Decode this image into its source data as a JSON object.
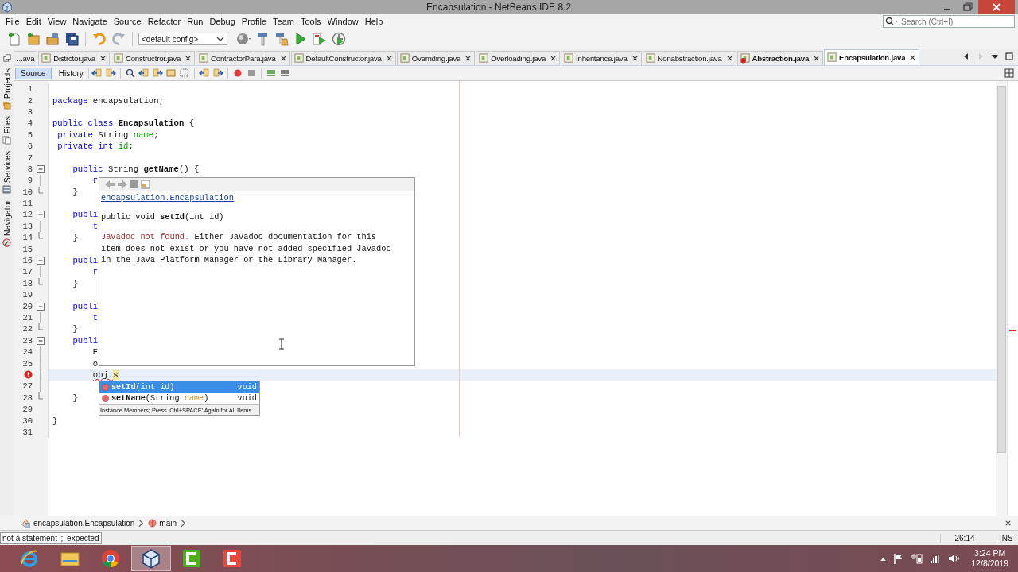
{
  "window": {
    "title": "Encapsulation - NetBeans IDE 8.2"
  },
  "menu": [
    "File",
    "Edit",
    "View",
    "Navigate",
    "Source",
    "Refactor",
    "Run",
    "Debug",
    "Profile",
    "Team",
    "Tools",
    "Window",
    "Help"
  ],
  "toolbar": {
    "config": "<default config>",
    "search": {
      "placeholder": "Search (Ctrl+I)"
    }
  },
  "side_tabs": [
    {
      "label": "Projects",
      "kind": "projects"
    },
    {
      "label": "Files",
      "kind": "files"
    },
    {
      "label": "Services",
      "kind": "services"
    },
    {
      "label": "Navigator",
      "kind": "navigator"
    }
  ],
  "tabs": [
    {
      "label": "...ava",
      "selected": false,
      "modified": false,
      "error": false,
      "closable": false
    },
    {
      "label": "Distrctor.java",
      "selected": false,
      "modified": false,
      "error": false,
      "closable": true
    },
    {
      "label": "Constructror.java",
      "selected": false,
      "modified": false,
      "error": false,
      "closable": true
    },
    {
      "label": "ContractorPara.java",
      "selected": false,
      "modified": false,
      "error": false,
      "closable": true
    },
    {
      "label": "DefaultConstructor.java",
      "selected": false,
      "modified": false,
      "error": false,
      "closable": true
    },
    {
      "label": "Overriding.java",
      "selected": false,
      "modified": false,
      "error": false,
      "closable": true
    },
    {
      "label": "Overloading.java",
      "selected": false,
      "modified": false,
      "error": false,
      "closable": true
    },
    {
      "label": "Inheritance.java",
      "selected": false,
      "modified": false,
      "error": false,
      "closable": true
    },
    {
      "label": "Nonabstraction.java",
      "selected": false,
      "modified": false,
      "error": false,
      "closable": true
    },
    {
      "label": "Abstraction.java",
      "selected": false,
      "modified": true,
      "error": true,
      "closable": true
    },
    {
      "label": "Encapsulation.java",
      "selected": true,
      "modified": true,
      "error": false,
      "closable": true
    }
  ],
  "editor_tabs": [
    {
      "label": "Source",
      "selected": true
    },
    {
      "label": "History",
      "selected": false
    }
  ],
  "editor": {
    "lines": [
      {
        "number": "1",
        "current": false
      },
      {
        "number": "2",
        "current": false,
        "segments": [
          {
            "text": "package",
            "kind": "keyword"
          },
          {
            "text": " encapsulation;",
            "kind": "plain"
          }
        ]
      },
      {
        "number": "3",
        "current": false
      },
      {
        "number": "4",
        "current": false,
        "segments": [
          {
            "text": "public class",
            "kind": "keyword"
          },
          {
            "text": " Encapsulation",
            "kind": "decl"
          },
          {
            "text": " {",
            "kind": "plain"
          }
        ]
      },
      {
        "number": "5",
        "current": false,
        "segments": [
          {
            "text": " private",
            "kind": "keyword"
          },
          {
            "text": " String ",
            "kind": "plain"
          },
          {
            "text": "name",
            "kind": "field"
          },
          {
            "text": ";",
            "kind": "plain"
          }
        ]
      },
      {
        "number": "6",
        "current": false,
        "segments": [
          {
            "text": " private int",
            "kind": "keyword"
          },
          {
            "text": " id",
            "kind": "field"
          },
          {
            "text": ";",
            "kind": "plain"
          }
        ]
      },
      {
        "number": "7",
        "current": false
      },
      {
        "number": "8",
        "current": false,
        "kind": "fold-start",
        "segments": [
          {
            "text": "    public",
            "kind": "keyword"
          },
          {
            "text": " String ",
            "kind": "plain"
          },
          {
            "text": "getName",
            "kind": "decl"
          },
          {
            "text": "() {",
            "kind": "plain"
          }
        ]
      },
      {
        "number": "9",
        "current": false,
        "kind": "fold-mid",
        "segments": [
          {
            "text": "        r",
            "kind": "keyword"
          }
        ]
      },
      {
        "number": "10",
        "current": false,
        "kind": "fold-end",
        "segments": [
          {
            "text": "    }",
            "kind": "plain"
          }
        ]
      },
      {
        "number": "11",
        "current": false
      },
      {
        "number": "12",
        "current": false,
        "kind": "fold-start",
        "segments": [
          {
            "text": "    publi",
            "kind": "keyword"
          }
        ]
      },
      {
        "number": "13",
        "current": false,
        "kind": "fold-mid",
        "segments": [
          {
            "text": "        t",
            "kind": "keyword"
          }
        ]
      },
      {
        "number": "14",
        "current": false,
        "kind": "fold-end",
        "segments": [
          {
            "text": "    }",
            "kind": "plain"
          }
        ]
      },
      {
        "number": "15",
        "current": false
      },
      {
        "number": "16",
        "current": false,
        "kind": "fold-start",
        "segments": [
          {
            "text": "    publi",
            "kind": "keyword"
          }
        ]
      },
      {
        "number": "17",
        "current": false,
        "kind": "fold-mid",
        "segments": [
          {
            "text": "        r",
            "kind": "keyword"
          }
        ]
      },
      {
        "number": "18",
        "current": false,
        "kind": "fold-end",
        "segments": [
          {
            "text": "    }",
            "kind": "plain"
          }
        ]
      },
      {
        "number": "19",
        "current": false
      },
      {
        "number": "20",
        "current": false,
        "kind": "fold-start",
        "segments": [
          {
            "text": "    publi",
            "kind": "keyword"
          }
        ]
      },
      {
        "number": "21",
        "current": false,
        "kind": "fold-mid",
        "segments": [
          {
            "text": "        t",
            "kind": "keyword"
          }
        ]
      },
      {
        "number": "22",
        "current": false,
        "kind": "fold-end",
        "segments": [
          {
            "text": "    }",
            "kind": "plain"
          }
        ]
      },
      {
        "number": "23",
        "current": false,
        "kind": "fold-start",
        "segments": [
          {
            "text": "    publi",
            "kind": "keyword"
          }
        ]
      },
      {
        "number": "24",
        "current": false,
        "kind": "fold-mid",
        "segments": [
          {
            "text": "        E",
            "kind": "plain"
          }
        ]
      },
      {
        "number": "25",
        "current": false,
        "kind": "fold-mid",
        "segments": [
          {
            "text": "        o",
            "kind": "plain"
          }
        ]
      },
      {
        "current": true,
        "marker": {
          "kind": "error"
        },
        "kind": "fold-mid",
        "segments": [
          {
            "text": "        obj.",
            "kind": "error"
          },
          {
            "text": "s",
            "kind": "typed"
          }
        ]
      },
      {
        "number": "27",
        "current": false,
        "kind": "fold-mid"
      },
      {
        "number": "28",
        "current": false,
        "kind": "fold-end",
        "segments": [
          {
            "text": "    }",
            "kind": "plain"
          }
        ]
      },
      {
        "number": "29",
        "current": false
      },
      {
        "number": "30",
        "current": false,
        "segments": [
          {
            "text": "}",
            "kind": "plain"
          }
        ]
      },
      {
        "number": "31",
        "current": false
      }
    ]
  },
  "javadoc": {
    "link": "encapsulation.Encapsulation",
    "signature": [
      {
        "text": "public void ",
        "kind": "plain"
      },
      {
        "text": "setId",
        "kind": "decl"
      },
      {
        "text": "(int id)",
        "kind": "plain"
      }
    ],
    "error": "Javadoc not found.",
    "text": "Either Javadoc documentation for this item does not exist or you have not added specified Javadoc in the Java Platform Manager or the Library Manager."
  },
  "completion": {
    "items": [
      {
        "selected": true,
        "segments": [
          {
            "text": "setId",
            "kind": "decl"
          },
          {
            "text": "(int id)",
            "kind": "plain"
          }
        ],
        "type": "void"
      },
      {
        "selected": false,
        "segments": [
          {
            "text": "setName",
            "kind": "decl"
          },
          {
            "text": "(String ",
            "kind": "plain"
          },
          {
            "text": "name",
            "kind": "param"
          },
          {
            "text": ")",
            "kind": "plain"
          }
        ],
        "type": "void"
      }
    ],
    "hint": "Instance Members; Press 'Ctrl+SPACE' Again for All Items"
  },
  "breadcrumb": [
    {
      "label": "encapsulation.Encapsulation",
      "kind": "class"
    },
    {
      "label": "main",
      "kind": "method"
    }
  ],
  "status_bar": {
    "message": "not a statement  ';' expected",
    "position": "26:14",
    "mode": "INS"
  },
  "taskbar": {
    "apps": [
      {
        "kind": "ie",
        "active": false
      },
      {
        "kind": "explorer",
        "active": false
      },
      {
        "kind": "chrome",
        "active": false
      },
      {
        "kind": "netbeans",
        "active": true
      },
      {
        "kind": "camtasia-green",
        "active": false
      },
      {
        "kind": "camtasia-red",
        "active": false
      }
    ],
    "time": "3:24 PM",
    "date": "12/8/2019"
  }
}
